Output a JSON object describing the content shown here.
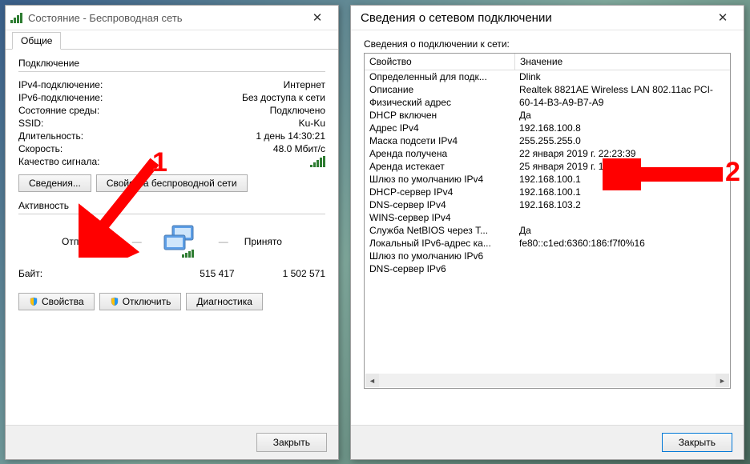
{
  "win1": {
    "title": "Состояние - Беспроводная сеть",
    "tab": "Общие",
    "group_conn": "Подключение",
    "rows": [
      {
        "k": "IPv4-подключение:",
        "v": "Интернет"
      },
      {
        "k": "IPv6-подключение:",
        "v": "Без доступа к сети"
      },
      {
        "k": "Состояние среды:",
        "v": "Подключено"
      },
      {
        "k": "SSID:",
        "v": "Ku-Ku"
      },
      {
        "k": "Длительность:",
        "v": "1 день 14:30:21"
      },
      {
        "k": "Скорость:",
        "v": "48.0 Мбит/с"
      }
    ],
    "quality_label": "Качество сигнала:",
    "btn_details": "Сведения...",
    "btn_wprops": "Свойства беспроводной сети",
    "group_act": "Активность",
    "sent": "Отправлено",
    "recv": "Принято",
    "bytes_label": "Байт:",
    "bytes_sent": "515 417",
    "bytes_recv": "1 502 571",
    "btn_props": "Свойства",
    "btn_disable": "Отключить",
    "btn_diag": "Диагностика",
    "btn_close": "Закрыть"
  },
  "win2": {
    "title": "Сведения о сетевом подключении",
    "label": "Сведения о подключении к сети:",
    "h1": "Свойство",
    "h2": "Значение",
    "rows": [
      {
        "p": "Определенный для подк...",
        "v": "Dlink"
      },
      {
        "p": "Описание",
        "v": "Realtek 8821AE Wireless LAN 802.11ac PCI-"
      },
      {
        "p": "Физический адрес",
        "v": "60-14-B3-A9-B7-A9"
      },
      {
        "p": "DHCP включен",
        "v": "Да"
      },
      {
        "p": "Адрес IPv4",
        "v": "192.168.100.8"
      },
      {
        "p": "Маска подсети IPv4",
        "v": "255.255.255.0"
      },
      {
        "p": "Аренда получена",
        "v": "22 января 2019 г. 22:23:39"
      },
      {
        "p": "Аренда истекает",
        "v": "25 января 2019 г. 12:49:36"
      },
      {
        "p": "Шлюз по умолчанию IPv4",
        "v": "192.168.100.1"
      },
      {
        "p": "DHCP-сервер IPv4",
        "v": "192.168.100.1"
      },
      {
        "p": "DNS-сервер IPv4",
        "v": "192.168.103.2"
      },
      {
        "p": "WINS-сервер IPv4",
        "v": ""
      },
      {
        "p": "Служба NetBIOS через T...",
        "v": "Да"
      },
      {
        "p": "Локальный IPv6-адрес ка...",
        "v": "fe80::c1ed:6360:186:f7f0%16"
      },
      {
        "p": "Шлюз по умолчанию IPv6",
        "v": ""
      },
      {
        "p": "DNS-сервер IPv6",
        "v": ""
      }
    ],
    "btn_close": "Закрыть"
  },
  "ann": {
    "n1": "1",
    "n2": "2"
  }
}
